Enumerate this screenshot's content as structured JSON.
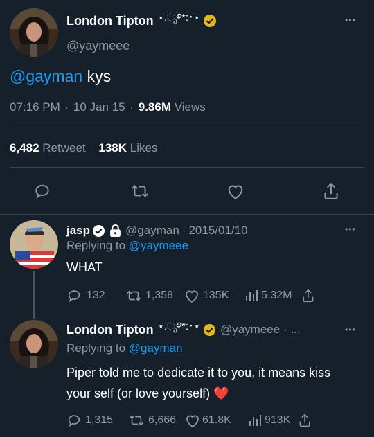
{
  "main_tweet": {
    "display_name": "London Tipton",
    "name_decor": "⋆.ೃ࿔*:･⋆",
    "handle": "@yaymeee",
    "mention": "@gayman",
    "text": "kys",
    "time": "07:16 PM",
    "sep1": "·",
    "date": "10 Jan 15",
    "sep2": "·",
    "views_count": "9.86M",
    "views_label": "Views",
    "retweets_count": "6,482",
    "retweets_label": "Retweet",
    "likes_count": "138K",
    "likes_label": "Likes"
  },
  "reply1": {
    "display_name": "jasp",
    "handle": "@gayman",
    "sep": "·",
    "date": "2015/01/10",
    "replying_prefix": "Replying to",
    "replying_to": "@yaymeee",
    "text": "WHAT",
    "replies": "132",
    "retweets": "1,358",
    "likes": "135K",
    "views": "5.32M"
  },
  "reply2": {
    "display_name": "London Tipton",
    "name_decor": "⋆.ೃ࿔*:･⋆",
    "handle": "@yaymeee",
    "trail": "· ...",
    "replying_prefix": "Replying to",
    "replying_to": "@gayman",
    "text": "Piper told me to dedicate it to you, it means kiss your self (or love yourself)",
    "heart_emoji": "❤️",
    "replies": "1,315",
    "retweets": "6,666",
    "likes": "61.8K",
    "views": "913K"
  },
  "icons": {
    "more": "•••",
    "verified": "verified-badge-icon",
    "lock": "lock-icon",
    "reply": "reply-icon",
    "retweet": "retweet-icon",
    "like": "heart-icon",
    "share": "share-icon",
    "views": "views-chart-icon"
  },
  "colors": {
    "background": "#15202b",
    "accent": "#1d9bf0",
    "muted": "#8b98a5",
    "divider": "#38444d",
    "gold": "#e2b719"
  }
}
